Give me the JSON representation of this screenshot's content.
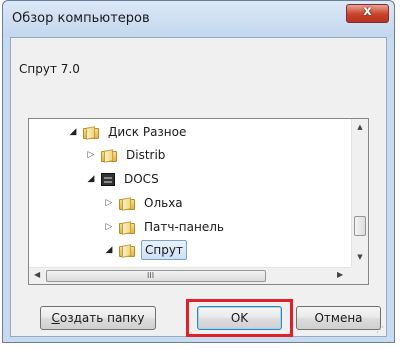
{
  "dialog": {
    "title": "Обзор компьютеров",
    "subtitle": "Спрут 7.0",
    "close_label": "x"
  },
  "tree": {
    "items": [
      {
        "label": "Диск Разное",
        "type": "folder",
        "expanded": true,
        "level": 0
      },
      {
        "label": "Distrib",
        "type": "folder",
        "expanded": false,
        "level": 1
      },
      {
        "label": "DOCS",
        "type": "drive",
        "expanded": true,
        "level": 1
      },
      {
        "label": "Ольха",
        "type": "folder",
        "expanded": false,
        "level": 2
      },
      {
        "label": "Патч-панель",
        "type": "folder",
        "expanded": false,
        "level": 2
      },
      {
        "label": "Спрут",
        "type": "folder",
        "expanded": true,
        "level": 2,
        "selected": true
      }
    ],
    "hscroll_grip": "III"
  },
  "buttons": {
    "new_folder": "Создать папку",
    "new_folder_mnemonic": "С",
    "new_folder_rest": "оздать папку",
    "ok": "OK",
    "cancel": "Отмена"
  },
  "colors": {
    "highlight": "#e0202a",
    "selection": "#cfe0f6"
  }
}
